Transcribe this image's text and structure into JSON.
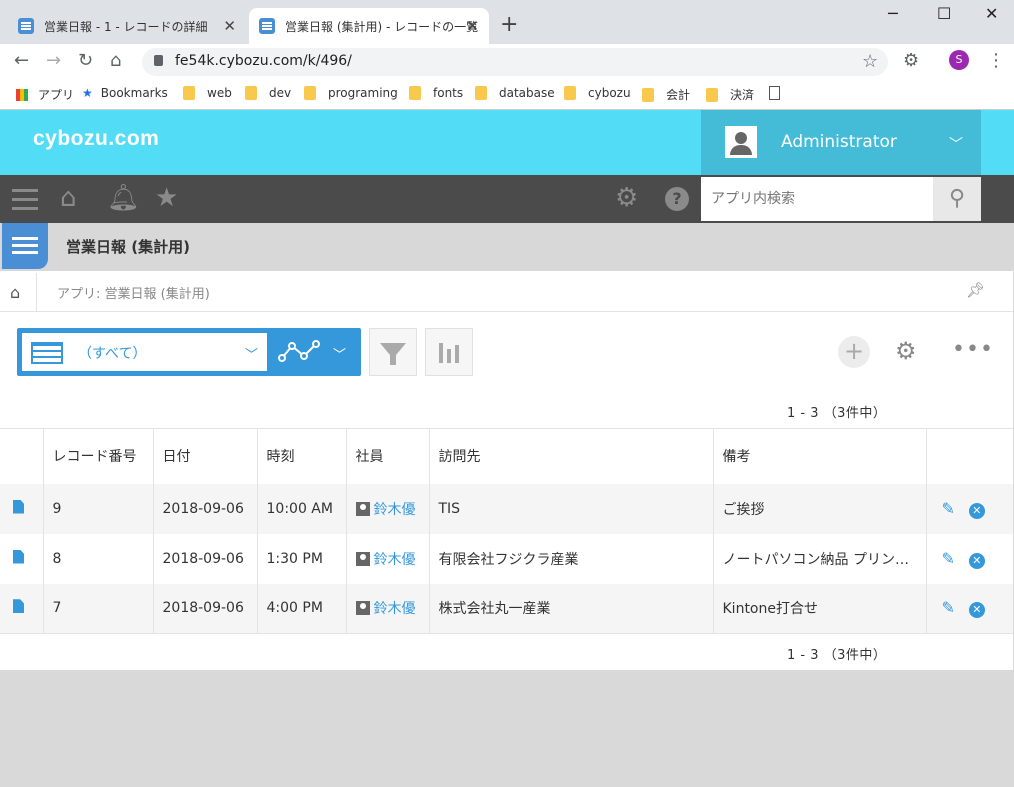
{
  "browser": {
    "tabs": [
      {
        "title": "営業日報 - 1 - レコードの詳細"
      },
      {
        "title": "営業日報 (集計用) - レコードの一覧"
      }
    ],
    "url": "fe54k.cybozu.com/k/496/",
    "profile_initial": "S",
    "bookmarks": [
      {
        "label": "アプリ"
      },
      {
        "label": "Bookmarks"
      },
      {
        "label": "web"
      },
      {
        "label": "dev"
      },
      {
        "label": "programing"
      },
      {
        "label": "fonts"
      },
      {
        "label": "database"
      },
      {
        "label": "cybozu"
      },
      {
        "label": "会計"
      },
      {
        "label": "決済"
      }
    ]
  },
  "header": {
    "logo": "cybozu.com",
    "user": "Administrator",
    "search_placeholder": "アプリ内検索"
  },
  "app": {
    "title": "営業日報 (集計用)",
    "breadcrumb": "アプリ: 営業日報 (集計用)",
    "view_label": "（すべて）",
    "count_text": "1 - 3 （3件中）"
  },
  "table": {
    "columns": [
      "レコード番号",
      "日付",
      "時刻",
      "社員",
      "訪問先",
      "備考"
    ],
    "rows": [
      {
        "id": "9",
        "date": "2018-09-06",
        "time": "10:00 AM",
        "employee": "鈴木優",
        "visit": "TIS",
        "note": "ご挨拶"
      },
      {
        "id": "8",
        "date": "2018-09-06",
        "time": "1:30 PM",
        "employee": "鈴木優",
        "visit": "有限会社フジクラ産業",
        "note": "ノートパソコン納品 プリン…"
      },
      {
        "id": "7",
        "date": "2018-09-06",
        "time": "4:00 PM",
        "employee": "鈴木優",
        "visit": "株式会社丸一産業",
        "note": "Kintone打合せ"
      }
    ]
  },
  "colors": {
    "header": "#53dcf6",
    "accent": "#3498db",
    "toolbar": "#4b4b4b"
  }
}
